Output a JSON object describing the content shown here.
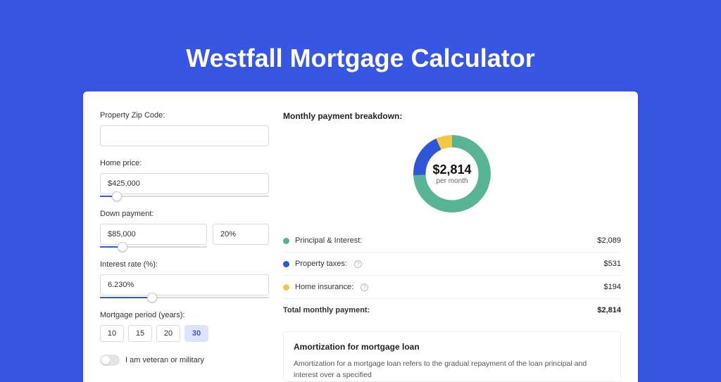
{
  "page": {
    "title": "Westfall Mortgage Calculator"
  },
  "form": {
    "zip_label": "Property Zip Code:",
    "zip_value": "",
    "home_price_label": "Home price:",
    "home_price_value": "$425,000",
    "home_price_slider_pct": 10,
    "down_label": "Down payment:",
    "down_amount": "$85,000",
    "down_pct": "20%",
    "down_slider_pct": 21,
    "rate_label": "Interest rate (%):",
    "rate_value": "6.230%",
    "rate_slider_pct": 31,
    "period_label": "Mortgage period (years):",
    "period_options": [
      "10",
      "15",
      "20",
      "30"
    ],
    "period_selected": "30",
    "veteran_label": "I am veteran or military"
  },
  "breakdown": {
    "heading": "Monthly payment breakdown:",
    "center_amount": "$2,814",
    "center_sub": "per month",
    "items": [
      {
        "label": "Principal & Interest:",
        "value": "$2,089",
        "color": "#57b495",
        "help": false
      },
      {
        "label": "Property taxes:",
        "value": "$531",
        "color": "#2f56d9",
        "help": true
      },
      {
        "label": "Home insurance:",
        "value": "$194",
        "color": "#f4c744",
        "help": true
      }
    ],
    "total_label": "Total monthly payment:",
    "total_value": "$2,814"
  },
  "amortization": {
    "title": "Amortization for mortgage loan",
    "text": "Amortization for a mortgage loan refers to the gradual repayment of the loan principal and interest over a specified"
  },
  "chart_data": {
    "type": "pie",
    "title": "Monthly payment breakdown",
    "unit": "USD per month",
    "series": [
      {
        "name": "Principal & Interest",
        "value": 2089,
        "color": "#57b495"
      },
      {
        "name": "Property taxes",
        "value": 531,
        "color": "#2f56d9"
      },
      {
        "name": "Home insurance",
        "value": 194,
        "color": "#f4c744"
      }
    ],
    "total": 2814,
    "donut": true
  }
}
